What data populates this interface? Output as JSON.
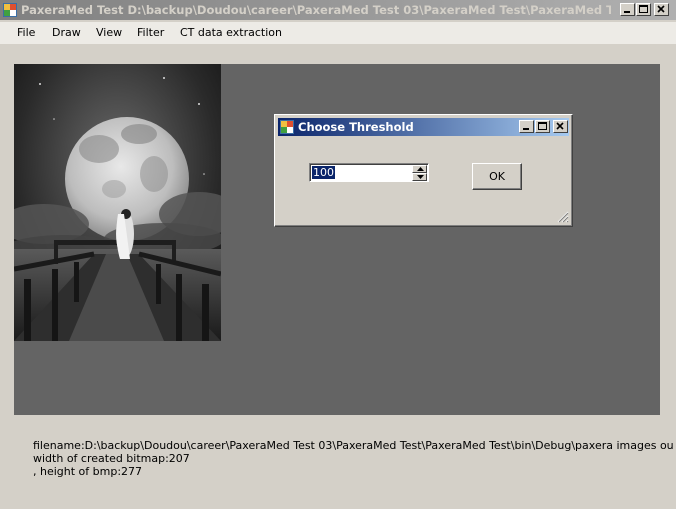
{
  "window": {
    "title": "PaxeraMed Test      D:\\backup\\Doudou\\career\\PaxeraMed Test 03\\PaxeraMed Test\\PaxeraMed Test\\bin\\Debug..."
  },
  "menu": {
    "items": [
      "File",
      "Draw",
      "View",
      "Filter",
      "CT data extraction"
    ]
  },
  "dialog": {
    "title": "Choose Threshold",
    "threshold_value": "100",
    "ok_label": "OK"
  },
  "status": {
    "filename_line": "filename:D:\\backup\\Doudou\\career\\PaxeraMed Test 03\\PaxeraMed Test\\PaxeraMed Test\\bin\\Debug\\paxera images output\\big_moon",
    "width_line": "width of created bitmap:207",
    "height_line": ", height of bmp:277"
  },
  "colors": {
    "panel_background": "#646464",
    "dialog_title_active": "#0a246a",
    "window_title_inactive": "#808080"
  },
  "icons": [
    "app-icon",
    "minimize-icon",
    "maximize-icon",
    "close-icon",
    "spin-up-icon",
    "spin-down-icon",
    "resize-grip-icon"
  ]
}
